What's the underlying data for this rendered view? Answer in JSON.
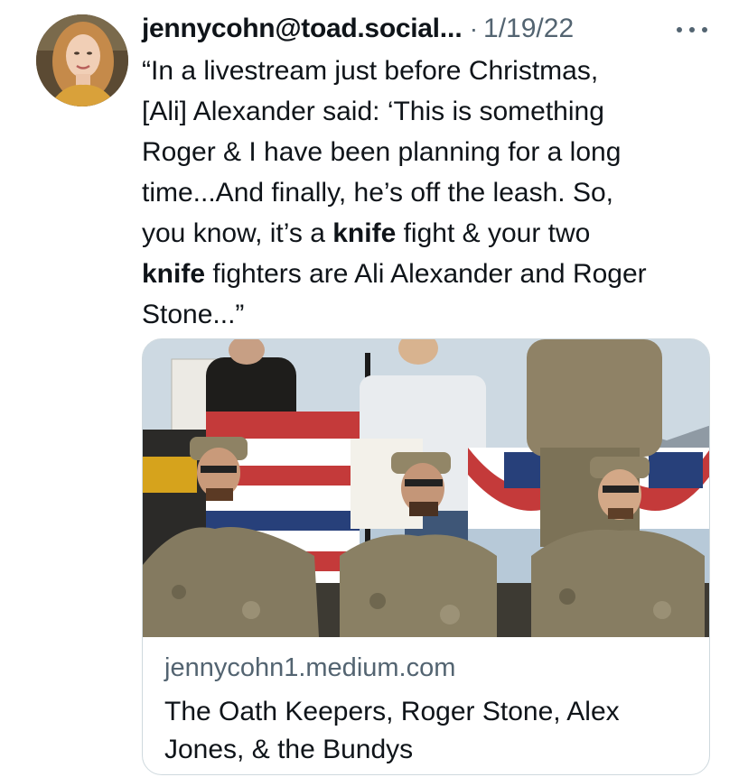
{
  "tweet": {
    "handle": "jennycohn@toad.social",
    "truncation": "...",
    "separator": "·",
    "date": "1/19/22",
    "more_icon": "more-horizontal-icon",
    "avatar_icon": "profile-avatar",
    "text": {
      "line1": "“In a livestream just before Christmas,",
      "line2": "[Ali] Alexander said: ‘This is something",
      "line3": "Roger & I have been planning for a long",
      "line4": "time...And finally, he’s off the leash. So,",
      "line5_pre": "you know, it’s a ",
      "line5_bold": "knife",
      "line5_post": " fight & your two",
      "line6_bold": "knife",
      "line6_post": " fighters are Ali Alexander and Roger",
      "line7": "Stone...”"
    }
  },
  "link_card": {
    "image_icon": "article-preview-photo",
    "domain": "jennycohn1.medium.com",
    "title": "The Oath Keepers, Roger Stone, Alex Jones, & the Bundys"
  },
  "colors": {
    "text_primary": "#0f1419",
    "text_secondary": "#536471",
    "card_border": "#cfd9de"
  }
}
